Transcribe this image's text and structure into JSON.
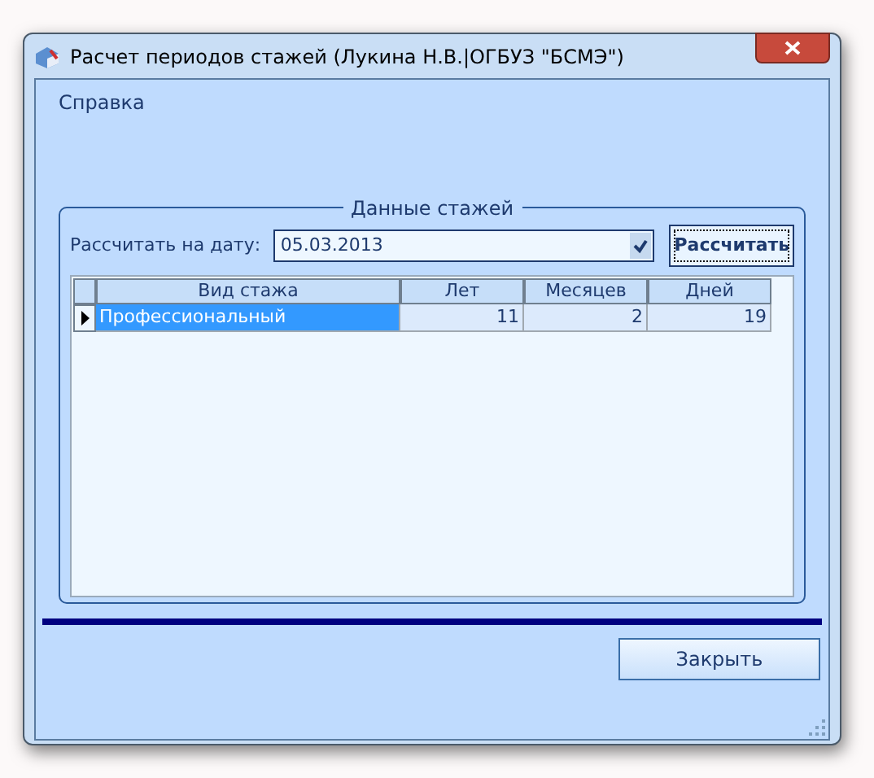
{
  "window": {
    "title": "Расчет периодов стажей (Лукина Н.В.|ОГБУЗ \"БСМЭ\")"
  },
  "menu": [
    "Справка"
  ],
  "group": {
    "title": "Данные стажей",
    "date_label": "Рассчитать на дату:",
    "date_value": "05.03.2013",
    "calculate_button": "Рассчитать"
  },
  "table": {
    "columns": [
      "Вид стажа",
      "Лет",
      "Месяцев",
      "Дней"
    ],
    "rows": [
      {
        "cells": [
          "Профессиональный",
          "11",
          "2",
          "19"
        ],
        "selected": true
      }
    ]
  },
  "buttons": [
    "Закрыть"
  ]
}
